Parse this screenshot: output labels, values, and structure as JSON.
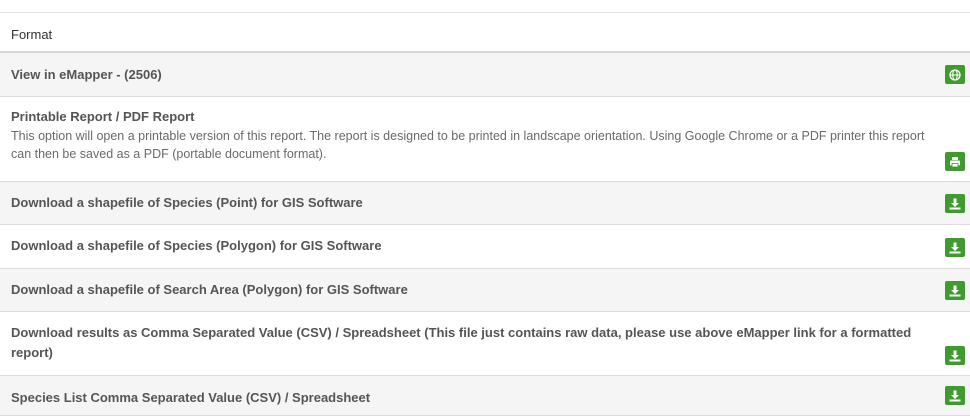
{
  "table": {
    "header": "Format",
    "rows": [
      {
        "label": "View in eMapper - (2506)",
        "icon": "globe-icon"
      },
      {
        "label": "Printable Report / PDF Report",
        "description": "This option will open a printable version of this report. The report is designed to be printed in landscape orientation. Using Google Chrome or a PDF printer this report can then be saved as a PDF (portable document format).",
        "icon": "print-icon"
      },
      {
        "label": "Download a shapefile of Species (Point) for GIS Software",
        "icon": "download-icon"
      },
      {
        "label": "Download a shapefile of Species (Polygon) for GIS Software",
        "icon": "download-icon"
      },
      {
        "label": "Download a shapefile of Search Area (Polygon) for GIS Software",
        "icon": "download-icon"
      },
      {
        "label": "Download results as Comma Separated Value (CSV) / Spreadsheet (This file just contains raw data, please use above eMapper link for a formatted report)",
        "icon": "download-icon"
      },
      {
        "label": "Species List Comma Separated Value (CSV) / Spreadsheet",
        "icon": "download-icon"
      }
    ]
  },
  "colors": {
    "button_green": "#3f9b2f",
    "row_alt": "#f5f5f5"
  }
}
